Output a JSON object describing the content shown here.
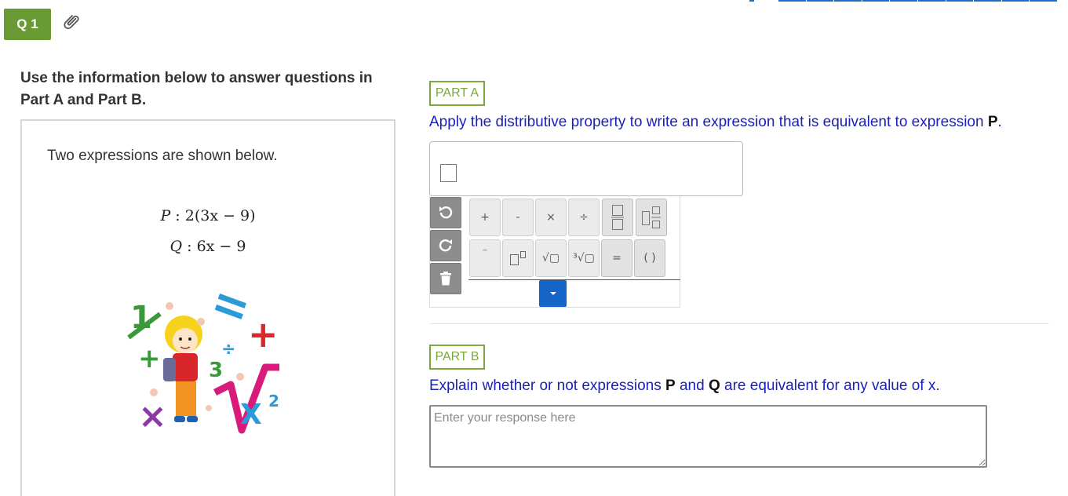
{
  "question": {
    "badge": "Q 1"
  },
  "stimulus": {
    "heading": "Use the information below to answer questions in Part A and Part B.",
    "intro": "Two expressions are shown below.",
    "expressions": [
      {
        "name": "P",
        "sep": " : ",
        "body": "2(3x − 9)"
      },
      {
        "name": "Q",
        "sep": " : ",
        "body": "6x − 9"
      }
    ],
    "image_icon": "math-kid-clipart-icon"
  },
  "part_a": {
    "badge": "PART A",
    "prompt_text": "Apply the distributive property to write an expression that is equivalent to expression ",
    "prompt_bold": "P",
    "prompt_end": ".",
    "editor": {
      "side_buttons": [
        "undo-icon",
        "redo-icon",
        "trash-icon"
      ],
      "row1": [
        "+",
        "-",
        "×",
        "÷"
      ],
      "row2": [
        "⁻",
        "",
        "√▢",
        "³√▢",
        "=",
        "( )"
      ],
      "dropdown_icon": "caret-down-icon"
    }
  },
  "part_b": {
    "badge": "PART B",
    "prompt_1": "Explain whether or not expressions ",
    "bold_1": "P",
    "prompt_2": " and ",
    "bold_2": "Q",
    "prompt_3": " are equivalent for any value of x.",
    "response_placeholder": "Enter your response here"
  },
  "colors": {
    "badge_green": "#6a9a34",
    "part_green": "#7aa83f",
    "prompt_blue": "#1a21b8",
    "accent_blue": "#1565c8"
  }
}
